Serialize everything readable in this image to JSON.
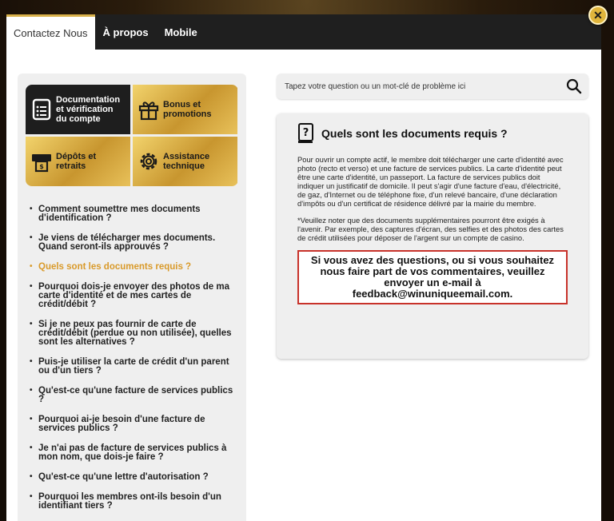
{
  "tabs": [
    {
      "label": "Contactez Nous",
      "active": true
    },
    {
      "label": "À propos",
      "active": false
    },
    {
      "label": "Mobile",
      "active": false
    }
  ],
  "close_label": "✕",
  "categories": [
    {
      "label": "Documentation et vérification du compte",
      "icon": "document-list-icon",
      "style": "dark"
    },
    {
      "label": "Bonus et promotions",
      "icon": "gift-icon",
      "style": "gold"
    },
    {
      "label": "Dépôts et retraits",
      "icon": "atm-icon",
      "style": "gold"
    },
    {
      "label": "Assistance technique",
      "icon": "gear-icon",
      "style": "gold"
    }
  ],
  "faq": [
    "Comment soumettre mes documents d'identification ?",
    "Je viens de télécharger mes documents. Quand seront-ils approuvés ?",
    "Quels sont les documents requis ?",
    "Pourquoi dois-je envoyer des photos de ma carte d'identité et de mes cartes de crédit/débit ?",
    "Si je ne peux pas fournir de carte de crédit/débit (perdue ou non utilisée), quelles sont les alternatives ?",
    "Puis-je utiliser la carte de crédit d'un parent ou d'un tiers ?",
    "Qu'est-ce qu'une facture de services publics ?",
    "Pourquoi ai-je besoin d'une facture de services publics ?",
    "Je n'ai pas de facture de services publics à mon nom, que dois-je faire ?",
    "Qu'est-ce qu'une lettre d'autorisation ?",
    "Pourquoi les membres ont-ils besoin d'un identifiant tiers ?"
  ],
  "faq_active_index": 2,
  "search": {
    "placeholder": "Tapez votre question ou un mot-clé de problème ici"
  },
  "content": {
    "title": "Quels sont les documents requis ?",
    "paragraph1": "Pour ouvrir un compte actif, le membre doit télécharger une carte d'identité avec photo (recto et verso) et une facture de services publics. La carte d'identité peut être une carte d'identité, un passeport. La facture de services publics doit indiquer un justificatif de domicile. Il peut s'agir d'une facture d'eau, d'électricité, de gaz, d'Internet ou de téléphone fixe, d'un relevé bancaire, d'une déclaration d'impôts ou d'un certificat de résidence délivré par la mairie du membre.",
    "paragraph2": "*Veuillez noter que des documents supplémentaires pourront être exigés à l'avenir. Par exemple, des captures d'écran, des selfies et des photos des cartes de crédit utilisées pour déposer de l'argent sur un compte de casino.",
    "notice": "Si vous avez des questions, ou si vous souhaitez nous faire part de vos commentaires, veuillez envoyer un e-mail à feedback@winuniqueemail.com."
  },
  "colors": {
    "accent_gold": "#d8b04a",
    "active_faq": "#d99a2a",
    "notice_border": "#c8322a",
    "tabbar": "#1f1f1f"
  }
}
